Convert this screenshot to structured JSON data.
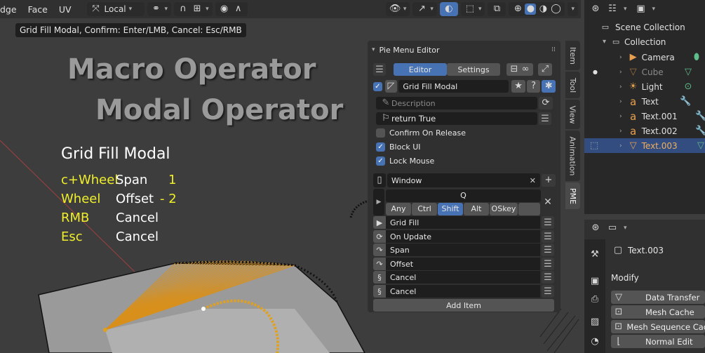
{
  "header": {
    "menus": [
      "dge",
      "Face",
      "UV"
    ],
    "transform_orientation": "Local"
  },
  "tooltip": "Grid Fill Modal, Confirm: Enter/LMB, Cancel: Esc/RMB",
  "overlay": {
    "macro_title": "Macro Operator",
    "modal_title": "Modal Operator",
    "heading": "Grid Fill Modal",
    "rows": [
      {
        "key": "c+Wheel",
        "action": "Span",
        "value": "1"
      },
      {
        "key": "Wheel",
        "action": "Offset",
        "value": "- 2"
      },
      {
        "key": "RMB",
        "action": "Cancel",
        "value": ""
      },
      {
        "key": "Esc",
        "action": "Cancel",
        "value": ""
      }
    ],
    "key_color": "#f0ef2a"
  },
  "pme": {
    "title": "Pie Menu Editor",
    "tabs": [
      "Editor",
      "Settings"
    ],
    "active_tab": "Editor",
    "menu_name": "Grid Fill Modal",
    "description_placeholder": "Description",
    "poll": "return True",
    "options": [
      {
        "label": "Confirm On Release",
        "checked": false
      },
      {
        "label": "Block UI",
        "checked": true
      },
      {
        "label": "Lock Mouse",
        "checked": true
      }
    ],
    "keymap": "Window",
    "hotkey": "Q",
    "modifiers": [
      "Any",
      "Ctrl",
      "Shift",
      "Alt",
      "OSkey"
    ],
    "active_modifier": "Shift",
    "items": [
      {
        "label": "Grid Fill",
        "icon": "play-icon"
      },
      {
        "label": "On Update",
        "icon": "refresh-icon"
      },
      {
        "label": "Span",
        "icon": "arrow-icon"
      },
      {
        "label": "Offset",
        "icon": "arrow-icon"
      },
      {
        "label": "Cancel",
        "icon": "python-icon"
      },
      {
        "label": "Cancel",
        "icon": "python-icon"
      }
    ],
    "add_item": "Add Item"
  },
  "side_tabs": [
    "Item",
    "Tool",
    "View",
    "Animation",
    "PME"
  ],
  "outliner": {
    "scene_collection": "Scene Collection",
    "collection": "Collection",
    "objects": [
      {
        "name": "Camera",
        "type": "camera",
        "color": "#e8a050"
      },
      {
        "name": "Cube",
        "type": "mesh",
        "color": "#e8a050",
        "dimmed": true
      },
      {
        "name": "Light",
        "type": "light",
        "color": "#e8a050"
      },
      {
        "name": "Text",
        "type": "text",
        "color": "#e8a050"
      },
      {
        "name": "Text.001",
        "type": "text",
        "color": "#e8a050"
      },
      {
        "name": "Text.002",
        "type": "text",
        "color": "#e8a050"
      },
      {
        "name": "Text.003",
        "type": "mesh",
        "color": "#e8a050",
        "selected": true
      }
    ]
  },
  "properties": {
    "object_name": "Text.003",
    "section": "Modify",
    "modifiers": [
      "Data Transfer",
      "Mesh Cache",
      "Mesh Sequence Cac",
      "Normal Edit"
    ]
  }
}
